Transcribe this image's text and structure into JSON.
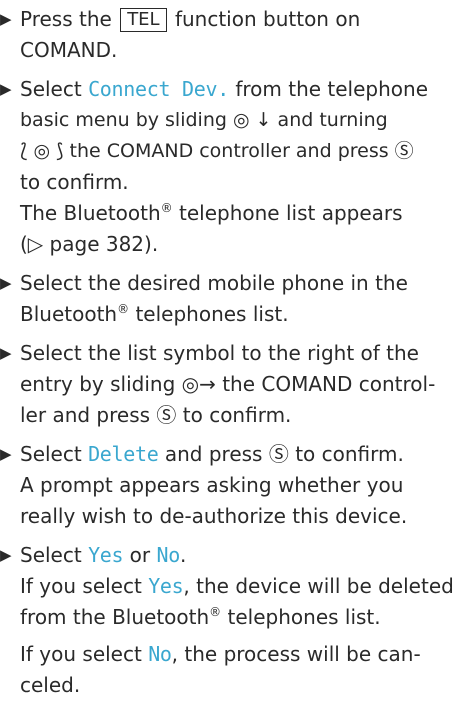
{
  "steps": [
    {
      "lines": [
        {
          "a": "Press the ",
          "key": "TEL",
          "b": " function button on"
        },
        {
          "a": "COMAND."
        }
      ]
    },
    {
      "lines": [
        {
          "a": "Select ",
          "cmd": "Connect Dev.",
          "b": " from the telephone"
        },
        {
          "a": "basic menu by sliding ◎ ↓ and turning"
        },
        {
          "a": "⟅ ◎ ⟆ the COMAND controller and press Ⓢ"
        },
        {
          "a": "to confirm."
        },
        {
          "a": "The Bluetooth",
          "sup": "®",
          "b": " telephone list appears"
        },
        {
          "a": "(▷ page 382)."
        }
      ]
    },
    {
      "lines": [
        {
          "a": "Select the desired mobile phone in the"
        },
        {
          "a": "Bluetooth",
          "sup": "®",
          "b": " telephones list."
        }
      ]
    },
    {
      "lines": [
        {
          "a": "Select the list symbol to the right of the"
        },
        {
          "a": "entry by sliding ◎→ the COMAND control-"
        },
        {
          "a": "ler and press Ⓢ to confirm."
        }
      ]
    },
    {
      "lines": [
        {
          "a": "Select ",
          "cmd": "Delete",
          "b": " and press Ⓢ to confirm."
        },
        {
          "a": "A prompt appears asking whether you"
        },
        {
          "a": "really wish to de-authorize this device."
        }
      ]
    },
    {
      "lines": [
        {
          "a": "Select ",
          "cmd": "Yes",
          "b": " or ",
          "cmd2": "No",
          "c": "."
        },
        {
          "a": "If you select ",
          "cmd": "Yes",
          "b": ", the device will be deleted"
        },
        {
          "a": "from the Bluetooth",
          "sup": "®",
          "b": " telephones list."
        },
        {
          "a": "If you select ",
          "cmd": "No",
          "b": ", the process will be can-"
        },
        {
          "a": "celed."
        }
      ]
    }
  ]
}
